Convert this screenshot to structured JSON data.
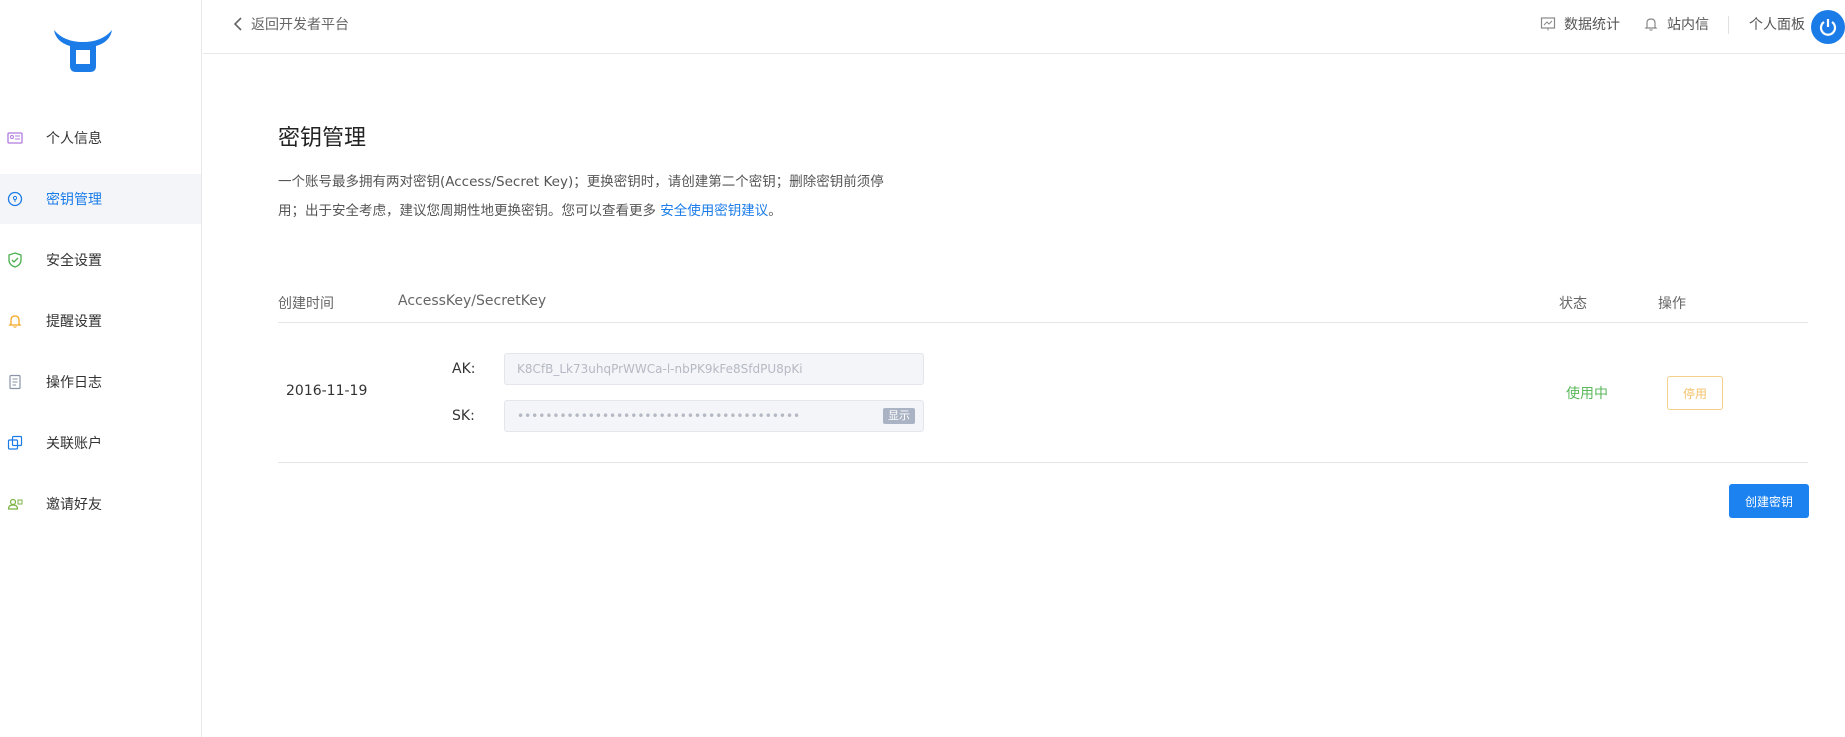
{
  "sidebar": {
    "items": [
      {
        "label": "个人信息",
        "icon": "id-card-icon",
        "color": "#b07be0",
        "active": false
      },
      {
        "label": "密钥管理",
        "icon": "key-icon",
        "color": "#1b7ce8",
        "active": true
      },
      {
        "label": "安全设置",
        "icon": "shield-icon",
        "color": "#4caf50",
        "active": false
      },
      {
        "label": "提醒设置",
        "icon": "bell-icon",
        "color": "#f5a623",
        "active": false
      },
      {
        "label": "操作日志",
        "icon": "log-icon",
        "color": "#8a94a6",
        "active": false
      },
      {
        "label": "关联账户",
        "icon": "link-accounts-icon",
        "color": "#1b7ce8",
        "active": false
      },
      {
        "label": "邀请好友",
        "icon": "invite-icon",
        "color": "#7cb342",
        "active": false
      }
    ]
  },
  "topbar": {
    "back_label": "返回开发者平台",
    "stats_label": "数据统计",
    "messages_label": "站内信",
    "panel_label": "个人面板"
  },
  "main": {
    "title": "密钥管理",
    "desc_line1": "一个账号最多拥有两对密钥(Access/Secret Key)；更换密钥时，请创建第二个密钥；删除密钥前须停",
    "desc_line2": "用；出于安全考虑，建议您周期性地更换密钥。您可以查看更多 ",
    "desc_link": "安全使用密钥建议",
    "desc_end": "。",
    "table": {
      "headers": {
        "created": "创建时间",
        "keys": "AccessKey/SecretKey",
        "status": "状态",
        "action": "操作"
      },
      "rows": [
        {
          "created": "2016-11-19",
          "ak_label": "AK:",
          "ak_value": "K8CfB_Lk73uhqPrWWCa-l-nbPK9kFe8SfdPU8pKi",
          "sk_label": "SK:",
          "sk_value": "••••••••••••••••••••••••••••••••••••••••",
          "show_label": "显示",
          "status": "使用中",
          "action_label": "停用"
        }
      ]
    },
    "create_label": "创建密钥"
  },
  "colors": {
    "accent": "#1b7ce8",
    "success": "#5cb85c",
    "warning": "#f5c26b"
  }
}
